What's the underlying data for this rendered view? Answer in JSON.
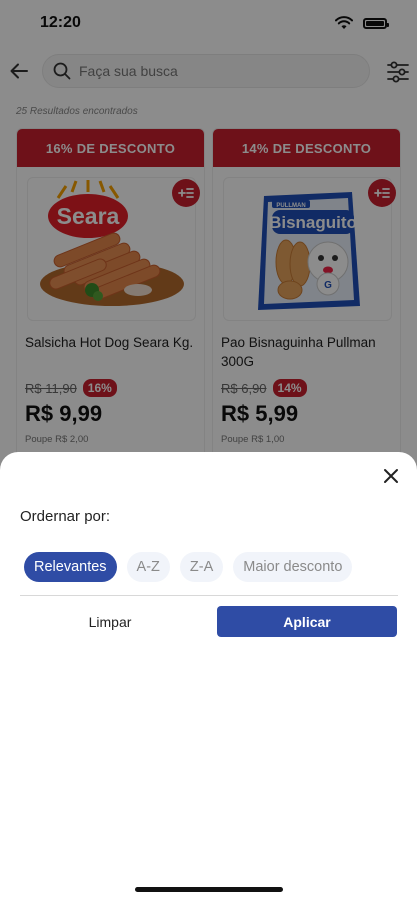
{
  "status_bar": {
    "time": "12:20"
  },
  "search": {
    "placeholder": "Faça sua busca"
  },
  "results_text": "25 Resultados encontrados",
  "products": [
    {
      "discount_banner": "16% DE DESCONTO",
      "brand": "Seara",
      "name": "Salsicha  Hot Dog Seara Kg.",
      "old_price": "R$ 11,90",
      "discount_badge": "16%",
      "price": "R$ 9,99",
      "savings": "Poupe R$ 2,00"
    },
    {
      "discount_banner": "14% DE DESCONTO",
      "brand": "Bisnaguito",
      "brand_small": "PULLMAN",
      "name": "Pao Bisnaguinha Pullman 300G",
      "old_price": "R$ 6,90",
      "discount_badge": "14%",
      "price": "R$ 5,99",
      "savings": "Poupe R$ 1,00"
    }
  ],
  "sort_sheet": {
    "title": "Ordernar por:",
    "options": [
      "Relevantes",
      "A-Z",
      "Z-A",
      "Maior desconto"
    ],
    "selected": "Relevantes",
    "clear_label": "Limpar",
    "apply_label": "Aplicar"
  },
  "colors": {
    "brand_red": "#c8202f",
    "brand_blue": "#2f4ca5"
  },
  "icons": [
    "back-arrow-icon",
    "search-icon",
    "filter-icon",
    "add-to-list-icon",
    "close-icon",
    "wifi-icon",
    "battery-icon"
  ]
}
